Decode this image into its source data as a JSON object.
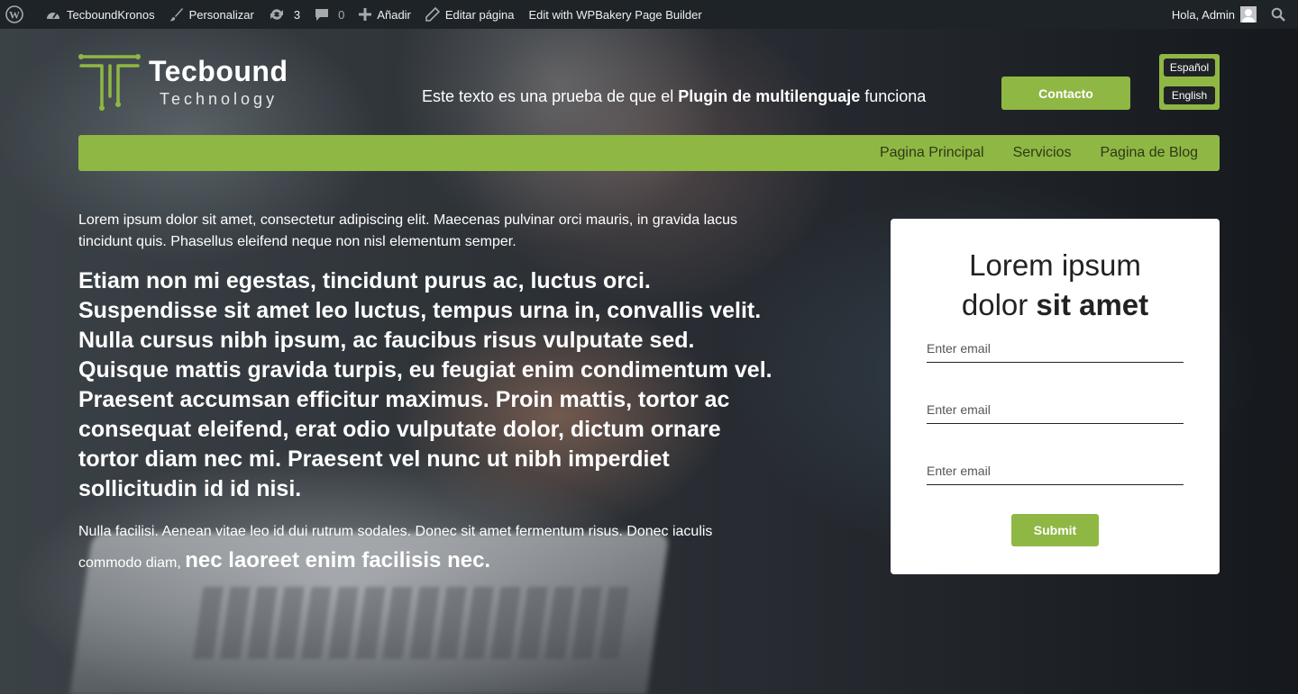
{
  "adminbar": {
    "site_name": "TecboundKronos",
    "customize": "Personalizar",
    "updates_count": "3",
    "comments_count": "0",
    "add_new": "Añadir",
    "edit_page": "Editar página",
    "wpbakery": "Edit with WPBakery Page Builder",
    "greeting": "Hola, Admin",
    "icons": [
      "wordpress-icon",
      "dashboard-icon",
      "brush-icon",
      "updates-icon",
      "comment-icon",
      "plus-icon",
      "pencil-icon",
      "search-icon"
    ]
  },
  "header": {
    "logo_name": "Tecbound",
    "logo_sub": "Technology",
    "tagline_pre": "Este texto es una prueba de que el ",
    "tagline_bold": "Plugin de multilenguaje",
    "tagline_post": " funciona",
    "contact_label": "Contacto",
    "languages": [
      "Español",
      "English"
    ]
  },
  "nav": {
    "items": [
      "Pagina Principal",
      "Servicios",
      "Pagina de Blog"
    ]
  },
  "content": {
    "para1": "Lorem ipsum dolor sit amet, consectetur adipiscing elit. Maecenas pulvinar orci mauris, in gravida lacus tincidunt quis. Phasellus eleifend neque non nisl elementum semper.",
    "para2": "Etiam non mi egestas, tincidunt purus ac, luctus orci. Suspendisse sit amet leo luctus, tempus urna in, convallis velit. Nulla cursus nibh ipsum, ac faucibus risus vulputate sed. Quisque mattis gravida turpis, eu feugiat enim condimentum vel. Praesent accumsan efficitur maximus. Proin mattis, tortor ac consequat eleifend, erat odio vulputate dolor, dictum ornare tortor diam nec mi. Praesent vel nunc ut nibh imperdiet sollicitudin id id nisi.",
    "para3_normal": "Nulla facilisi. Aenean vitae leo id dui rutrum sodales. Donec sit amet fermentum risus. Donec iaculis commodo diam, ",
    "para3_big": "nec laoreet enim facilisis nec."
  },
  "form": {
    "title_line1": "Lorem ipsum",
    "title_line2_normal": "dolor ",
    "title_line2_bold": "sit amet",
    "field_placeholder": "Enter email",
    "submit_label": "Submit"
  },
  "colors": {
    "accent": "#8fb744",
    "adminbar": "#1d2327",
    "card": "#ffffff"
  }
}
